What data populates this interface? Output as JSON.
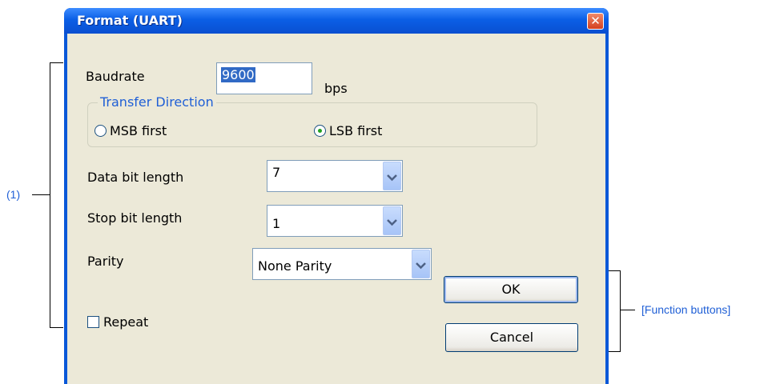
{
  "window": {
    "title": "Format (UART)"
  },
  "form": {
    "baudrate_label": "Baudrate",
    "baudrate_value": "9600",
    "baudrate_unit": "bps",
    "transfer_direction": {
      "title": "Transfer Direction",
      "options": [
        {
          "label": "MSB first",
          "selected": false
        },
        {
          "label": "LSB first",
          "selected": true
        }
      ]
    },
    "data_bit_length": {
      "label": "Data bit length",
      "value": "7"
    },
    "stop_bit_length": {
      "label": "Stop bit length",
      "value": "1"
    },
    "parity": {
      "label": "Parity",
      "value": "None Parity"
    },
    "repeat": {
      "label": "Repeat",
      "checked": false
    }
  },
  "buttons": {
    "ok": "OK",
    "cancel": "Cancel"
  },
  "annotations": {
    "section1": "(1)",
    "function_buttons": "[Function buttons]"
  },
  "colors": {
    "titlebar": "#0a58d8",
    "client": "#ece9d8",
    "annotation": "#1f5fd6",
    "selection": "#316ac5"
  }
}
